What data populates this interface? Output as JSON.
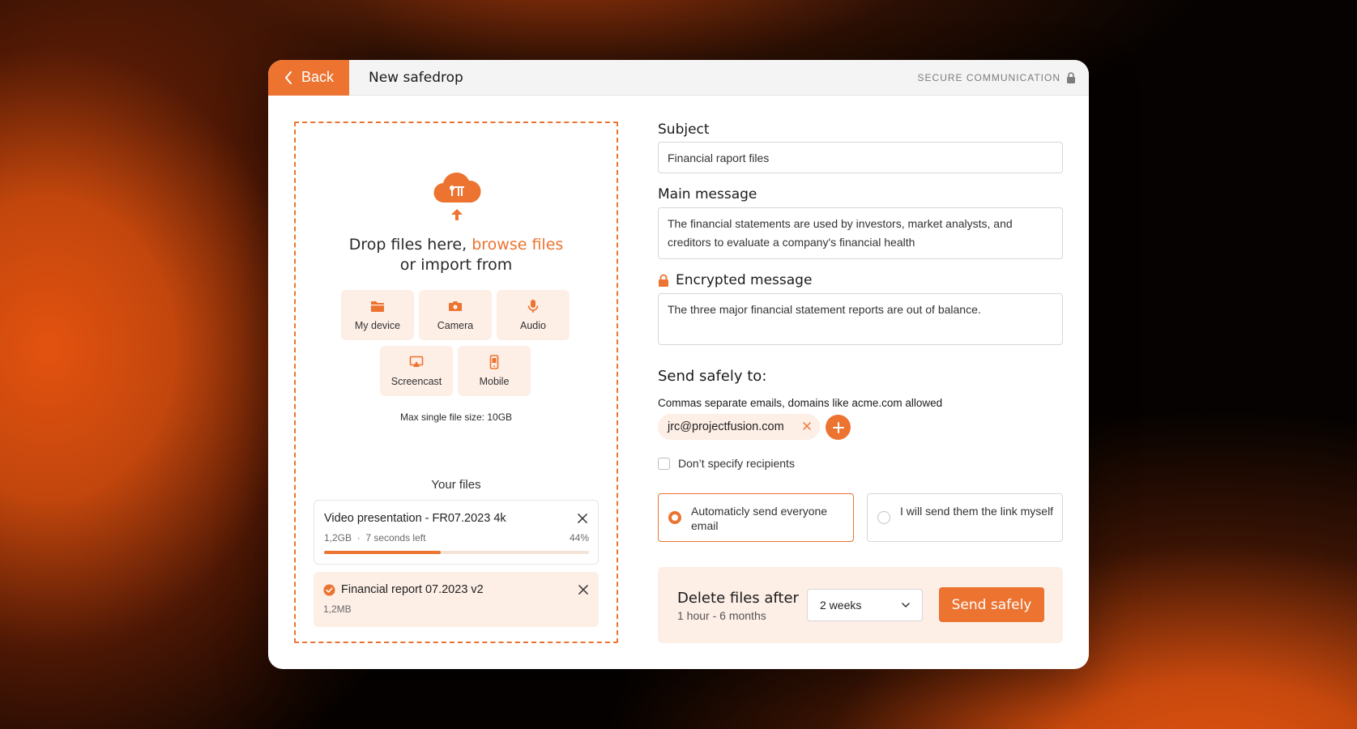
{
  "colors": {
    "accent": "#ec7330",
    "accent_soft": "#fdeee6"
  },
  "titlebar": {
    "back_label": "Back",
    "title": "New safedrop",
    "secure_label": "SECURE COMMUNICATION"
  },
  "dropzone": {
    "text_before_link": "Drop files here, ",
    "browse_link": "browse files",
    "text_line2": "or import from",
    "sources": [
      {
        "label": "My device",
        "icon": "folder-icon"
      },
      {
        "label": "Camera",
        "icon": "camera-icon"
      },
      {
        "label": "Audio",
        "icon": "microphone-icon"
      },
      {
        "label": "Screencast",
        "icon": "screencast-icon"
      },
      {
        "label": "Mobile",
        "icon": "mobile-icon"
      }
    ],
    "max_size": "Max single file size: 10GB",
    "your_files": "Your files",
    "files": [
      {
        "name": "Video presentation - FR07.2023 4k",
        "size": "1,2GB",
        "separator": "·",
        "time_left": "7 seconds left",
        "progress_label": "44%",
        "progress": 0.44
      },
      {
        "name": "Financial report 07.2023 v2",
        "size": "1,2MB",
        "status": "complete"
      }
    ]
  },
  "form": {
    "subject_label": "Subject",
    "subject_value": "Financial raport files",
    "main_message_label": "Main message",
    "main_message_value": "The financial statements are used by investors, market analysts, and creditors to evaluate a company's financial health",
    "encrypted_label": "Encrypted message",
    "encrypted_value": "The three major financial statement reports are out of balance.",
    "send_to_title": "Send safely to:",
    "send_to_hint": "Commas separate emails, domains like acme.com allowed",
    "recipients": [
      "jrc@projectfusion.com"
    ],
    "dont_specify_label": "Don’t specify recipients",
    "option_auto": "Automaticly send everyone email",
    "option_manual": "I will send them the link myself",
    "delete_title": "Delete files after",
    "delete_range": "1 hour - 6 months",
    "delete_selected": "2 weeks",
    "send_label": "Send safely"
  }
}
